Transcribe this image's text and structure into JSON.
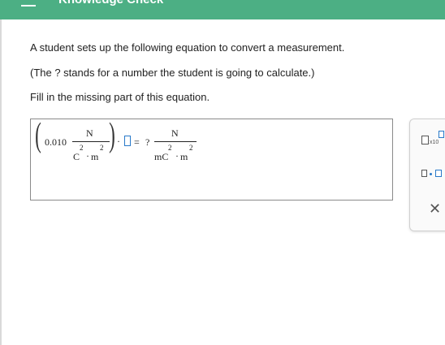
{
  "header": {
    "title": "Knowledge Check",
    "accent_color": "#4caf84"
  },
  "question": {
    "line1": "A student sets up the following equation to convert a measurement.",
    "line2": "(The ? stands for a number the student is going to calculate.)",
    "line3": "Fill in the missing part of this equation."
  },
  "equation": {
    "coefficient": "0.010",
    "left_num": "N",
    "left_den_a": "C",
    "left_den_a_exp": "2",
    "left_den_dot": "·",
    "left_den_b": "m",
    "left_den_b_exp": "2",
    "times": "·",
    "equals": "=",
    "unknown": "?",
    "right_num": "N",
    "right_den_a": "mC",
    "right_den_a_exp": "2",
    "right_den_dot": "·",
    "right_den_b": "m",
    "right_den_b_exp": "2"
  },
  "toolbar": {
    "sci_notation_label": "x10",
    "multiply_dot": "·",
    "close_label": "✕",
    "icons": [
      "scientific-notation-icon",
      "multiply-units-icon",
      "close-icon"
    ]
  }
}
